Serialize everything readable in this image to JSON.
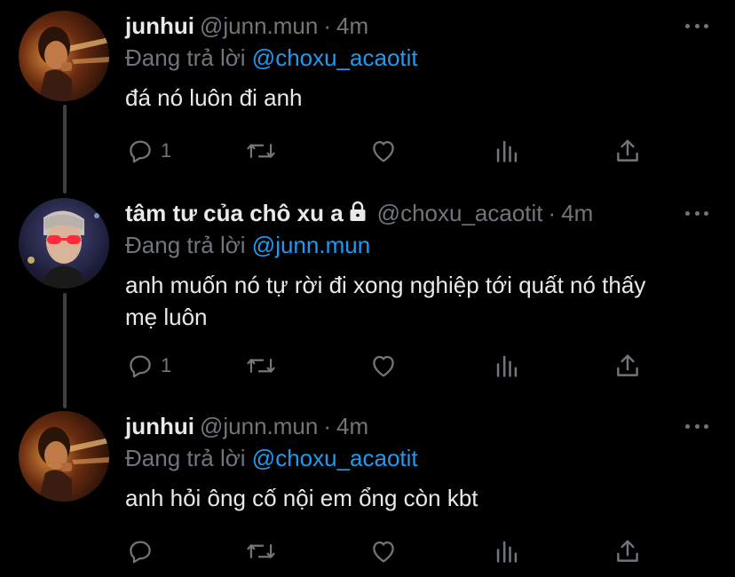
{
  "tweets": [
    {
      "name": "junhui",
      "handle": "@junn.mun",
      "separator": "·",
      "time": "4m",
      "replying_label": "Đang trả lời",
      "replying_to": "@choxu_acaotit",
      "text": "đá nó luôn đi anh",
      "avatar_icon": "avatar-junhui",
      "reply_count": "1",
      "locked": false
    },
    {
      "name": "tâm tư của chô xu a",
      "handle": "@choxu_acaotit",
      "separator": "·",
      "time": "4m",
      "replying_label": "Đang trả lời",
      "replying_to": "@junn.mun",
      "text": "anh muốn nó tự rời đi xong nghiệp tới quất nó thấy mẹ luôn",
      "avatar_icon": "avatar-choxu",
      "reply_count": "1",
      "locked": true
    },
    {
      "name": "junhui",
      "handle": "@junn.mun",
      "separator": "·",
      "time": "4m",
      "replying_label": "Đang trả lời",
      "replying_to": "@choxu_acaotit",
      "text": "anh hỏi ông cố nội em ổng còn kbt",
      "avatar_icon": "avatar-junhui",
      "reply_count": "",
      "locked": false
    }
  ],
  "colors": {
    "background": "#000000",
    "text": "#e7e9ea",
    "muted": "#71767b",
    "link": "#1d9bf0",
    "thread_line": "#3e4144"
  },
  "icons": [
    "reply-icon",
    "retweet-icon",
    "like-icon",
    "analytics-icon",
    "share-icon",
    "more-icon",
    "lock-icon"
  ]
}
